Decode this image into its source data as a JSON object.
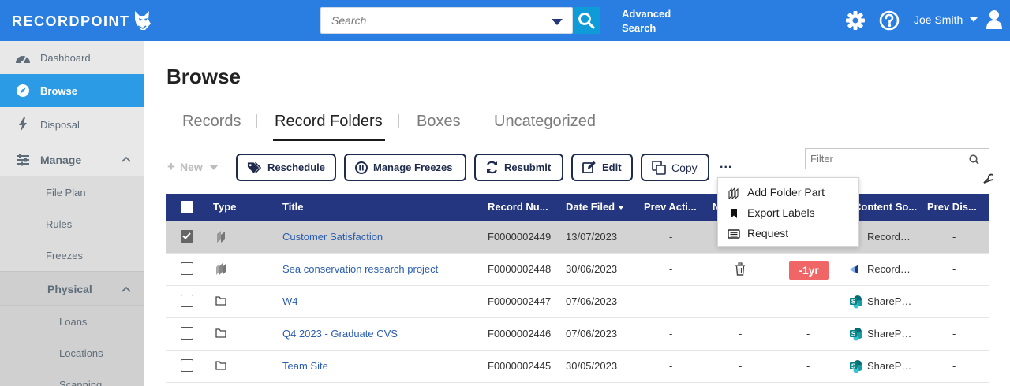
{
  "app": {
    "logo_text": "RECORDPOINT",
    "search": {
      "placeholder": "Search"
    },
    "advanced_search": {
      "line1": "Advanced",
      "line2": "Search"
    },
    "user_name": "Joe Smith"
  },
  "sidebar": {
    "items": [
      {
        "label": "Dashboard",
        "icon": "speedometer-icon"
      },
      {
        "label": "Browse",
        "icon": "compass-icon",
        "active": true
      },
      {
        "label": "Disposal",
        "icon": "lightning-icon"
      },
      {
        "label": "Manage",
        "icon": "sliders-icon",
        "expanded": true
      }
    ],
    "manage_sub": [
      "File Plan",
      "Rules",
      "Freezes"
    ],
    "physical": {
      "label": "Physical",
      "expanded": true
    },
    "physical_sub": [
      "Loans",
      "Locations",
      "Scanning"
    ]
  },
  "main": {
    "title": "Browse",
    "tabs": [
      "Records",
      "Record Folders",
      "Boxes",
      "Uncategorized"
    ],
    "active_tab": "Record Folders",
    "toolbar": {
      "new_label": "New",
      "reschedule_label": "Reschedule",
      "manage_freezes_label": "Manage Freezes",
      "resubmit_label": "Resubmit",
      "edit_label": "Edit",
      "copy_label": "Copy",
      "more_label": "..."
    },
    "filter": {
      "placeholder": "Filter"
    }
  },
  "more_menu": {
    "items": [
      {
        "label": "Add Folder Part",
        "icon": "folder-part-icon"
      },
      {
        "label": "Export Labels",
        "icon": "bookmark-icon"
      },
      {
        "label": "Request",
        "icon": "list-card-icon"
      }
    ]
  },
  "table": {
    "columns": [
      "Type",
      "Title",
      "Record Nu...",
      "Date Filed",
      "Prev Acti...",
      "N",
      "Content So...",
      "Prev Dis..."
    ],
    "sorted_column": "Date Filed",
    "rows": [
      {
        "checked": true,
        "type_icon": "folder-part-icon",
        "title": "Customer Satisfaction",
        "record_number": "F0000002449",
        "date_filed": "13/07/2023",
        "prev_action": "-",
        "col_n": "",
        "col_badge": "",
        "content_source": "Record…",
        "content_icon": "recordpoint-icon",
        "prev_disposal": "-"
      },
      {
        "checked": false,
        "type_icon": "folder-part-icon",
        "title": "Sea conservation research project",
        "record_number": "F0000002448",
        "date_filed": "30/06/2023",
        "prev_action": "-",
        "col_n": "trash-icon",
        "col_badge": "-1yr",
        "content_source": "Record…",
        "content_icon": "recordpoint-icon",
        "prev_disposal": "-"
      },
      {
        "checked": false,
        "type_icon": "folder-icon",
        "title": "W4",
        "record_number": "F0000002447",
        "date_filed": "07/06/2023",
        "prev_action": "-",
        "col_n": "-",
        "col_badge": "-",
        "content_source": "ShareP…",
        "content_icon": "sharepoint-icon",
        "prev_disposal": "-"
      },
      {
        "checked": false,
        "type_icon": "folder-icon",
        "title": "Q4 2023 - Graduate CVS",
        "record_number": "F0000002446",
        "date_filed": "07/06/2023",
        "prev_action": "-",
        "col_n": "-",
        "col_badge": "-",
        "content_source": "ShareP…",
        "content_icon": "sharepoint-icon",
        "prev_disposal": "-"
      },
      {
        "checked": false,
        "type_icon": "folder-icon",
        "title": "Team Site",
        "record_number": "F0000002445",
        "date_filed": "30/05/2023",
        "prev_action": "-",
        "col_n": "-",
        "col_badge": "-",
        "content_source": "ShareP…",
        "content_icon": "sharepoint-icon",
        "prev_disposal": "-"
      }
    ]
  },
  "colors": {
    "topbar": "#2a7de1",
    "table_header": "#253680",
    "active_nav": "#2c9be6",
    "badge_red": "#f06565",
    "link": "#2a5db0"
  }
}
